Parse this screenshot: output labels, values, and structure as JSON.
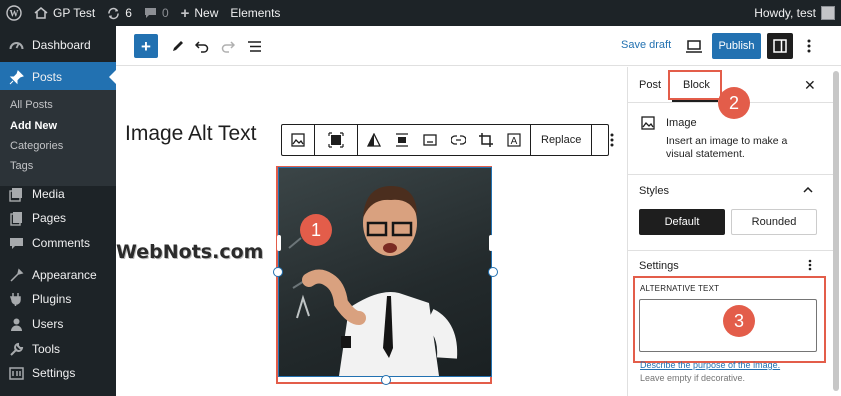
{
  "admin_bar": {
    "site_name": "GP Test",
    "updates_count": "6",
    "comments_count": "0",
    "new_label": "New",
    "elements_label": "Elements",
    "greeting": "Howdy, test"
  },
  "sidebar": {
    "items": [
      {
        "label": "Dashboard",
        "icon": "dashboard-icon"
      },
      {
        "label": "Posts",
        "icon": "pin-icon"
      },
      {
        "label": "Media",
        "icon": "media-icon"
      },
      {
        "label": "Pages",
        "icon": "pages-icon"
      },
      {
        "label": "Comments",
        "icon": "comments-icon"
      },
      {
        "label": "Appearance",
        "icon": "appearance-icon"
      },
      {
        "label": "Plugins",
        "icon": "plugins-icon"
      },
      {
        "label": "Users",
        "icon": "users-icon"
      },
      {
        "label": "Tools",
        "icon": "tools-icon"
      },
      {
        "label": "Settings",
        "icon": "settings-icon"
      }
    ],
    "posts_submenu": [
      "All Posts",
      "Add New",
      "Categories",
      "Tags"
    ]
  },
  "editor_toolbar": {
    "save_draft": "Save draft",
    "publish": "Publish"
  },
  "canvas": {
    "post_title": "Image Alt Text",
    "block_toolbar_replace": "Replace",
    "watermark": "WebNots.com"
  },
  "settings_panel": {
    "tab_post": "Post",
    "tab_block": "Block",
    "block_name": "Image",
    "block_description": "Insert an image to make a visual statement.",
    "styles_title": "Styles",
    "style_default": "Default",
    "style_rounded": "Rounded",
    "settings_title": "Settings",
    "alt_label": "ALTERNATIVE TEXT",
    "alt_value": "",
    "alt_help_link": "Describe the purpose of the image.",
    "alt_help": "Leave empty if decorative."
  },
  "annotations": [
    "1",
    "2",
    "3"
  ],
  "colors": {
    "admin_dark": "#1d2327",
    "wp_blue": "#2271b1",
    "annotation_red": "#e35d4a"
  }
}
